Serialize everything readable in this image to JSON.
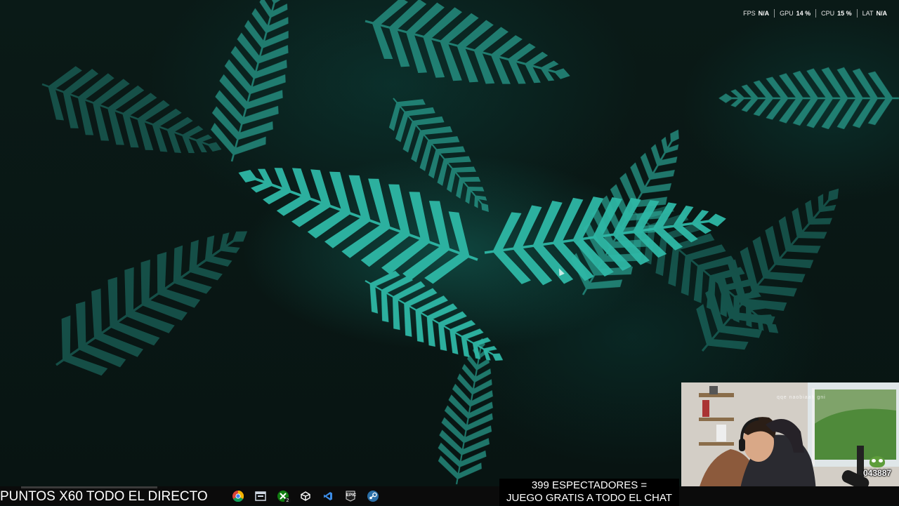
{
  "perf_overlay": {
    "fps": {
      "label": "FPS",
      "value": "N/A"
    },
    "gpu": {
      "label": "GPU",
      "value": "14 %"
    },
    "cpu": {
      "label": "CPU",
      "value": "15 %"
    },
    "lat": {
      "label": "LAT",
      "value": "N/A"
    }
  },
  "ticker": {
    "text": "PUNTOS X60 TODO EL DIRECTO"
  },
  "viewer_banner": {
    "line1": "399 ESPECTADORES =",
    "line2": "JUEGO GRATIS A TODO EL CHAT"
  },
  "taskbar_icons": [
    {
      "name": "chrome-icon"
    },
    {
      "name": "window-manager-icon"
    },
    {
      "name": "xbox-icon",
      "badge": "2"
    },
    {
      "name": "unity-icon"
    },
    {
      "name": "visual-studio-icon"
    },
    {
      "name": "epic-games-icon",
      "text": "EPIC"
    },
    {
      "name": "steam-icon"
    }
  ],
  "webcam": {
    "watermark": "qqe naobiaah gni",
    "points": "043887"
  },
  "colors": {
    "fern": "#2fb8a6",
    "background": "#07110f",
    "taskbar": "#0b0b0b"
  }
}
